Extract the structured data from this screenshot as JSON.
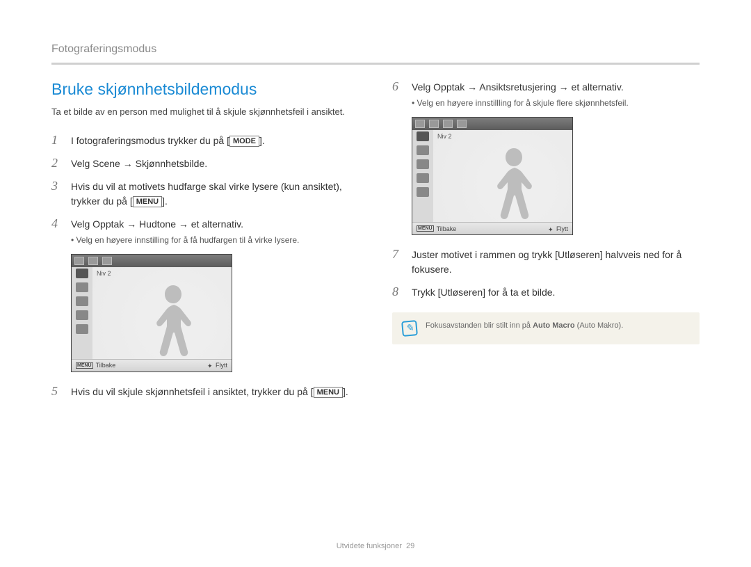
{
  "header": {
    "section": "Fotograferingsmodus"
  },
  "title": "Bruke skjønnhetsbildemodus",
  "intro": "Ta et bilde av en person med mulighet til å skjule skjønnhetsfeil i ansiktet.",
  "labels": {
    "mode": "MODE",
    "menu": "MENU",
    "tilbake": "Tilbake",
    "flytt": "Flytt",
    "niv": "Niv  2"
  },
  "steps": {
    "s1": "I fotograferingsmodus trykker du på [",
    "s1b": "].",
    "s2": "Velg Scene → Skjønnhetsbilde.",
    "s3": "Hvis du vil at motivets hudfarge skal virke lysere (kun ansiktet), trykker du på [",
    "s3b": "].",
    "s4": "Velg Opptak → Hudtone → et alternativ.",
    "s4sub": "Velg en høyere innstilling for å få hudfargen til å virke lysere.",
    "s5": "Hvis du vil skjule skjønnhetsfeil i ansiktet, trykker du på [",
    "s5b": "].",
    "s6": "Velg Opptak → Ansiktsretusjering → et alternativ.",
    "s6sub": "Velg en høyere innstillling for å skjule flere skjønnhetsfeil.",
    "s7": "Juster motivet i rammen og trykk [Utløseren] halvveis ned for å fokusere.",
    "s8": "Trykk [Utløseren] for å ta et bilde."
  },
  "tip": {
    "pre": "Fokusavstanden blir stilt inn på ",
    "bold": "Auto Macro",
    "post": " (Auto Makro)."
  },
  "footer": {
    "text": "Utvidete funksjoner",
    "page": "29"
  }
}
